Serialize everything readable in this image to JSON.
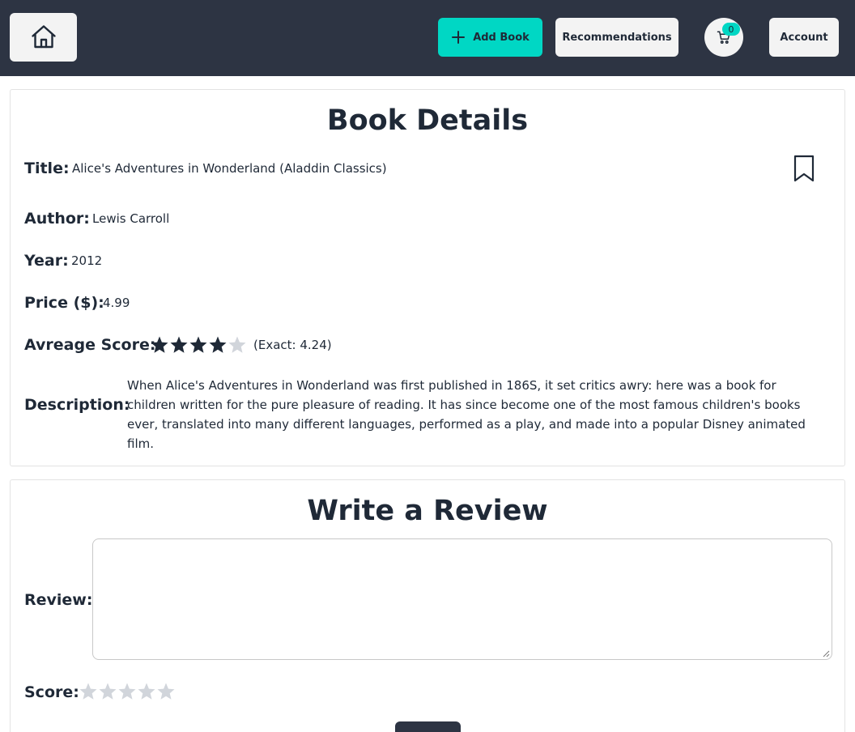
{
  "header": {
    "add_book_label": "Add Book",
    "recommendations_label": "Recommendations",
    "cart_count": "0",
    "account_label": "Account"
  },
  "details": {
    "heading": "Book Details",
    "title_label": "Title:",
    "title_value": "Alice's Adventures in Wonderland (Aladdin Classics)",
    "author_label": "Author:",
    "author_value": "Lewis Carroll",
    "year_label": "Year:",
    "year_value": "2012",
    "price_label": "Price ($):",
    "price_value": "4.99",
    "score_label": "Avreage Score:",
    "score_stars_filled": 4,
    "score_stars_total": 5,
    "score_exact": "(Exact: 4.24)",
    "description_label": "Description:",
    "description_value": "When Alice's Adventures in Wonderland was first published in 186S, it set critics awry: here was a book for children written for the pure pleasure of reading. It has since become one of the most famous children's books ever, translated into many different languages, performed as a play, and made into a popular Disney animated film."
  },
  "review": {
    "heading": "Write a Review",
    "review_label": "Review:",
    "review_value": "",
    "score_label": "Score:",
    "score_stars_filled": 0,
    "score_stars_total": 5
  },
  "colors": {
    "topbar": "#2d3443",
    "accent": "#00d7c4",
    "star_filled": "#1f2937",
    "star_empty": "#d1d5db"
  },
  "icons": {
    "home": "home-icon",
    "add": "plus-icon",
    "cart": "cart-icon",
    "bookmark": "bookmark-icon",
    "star": "star-icon"
  }
}
